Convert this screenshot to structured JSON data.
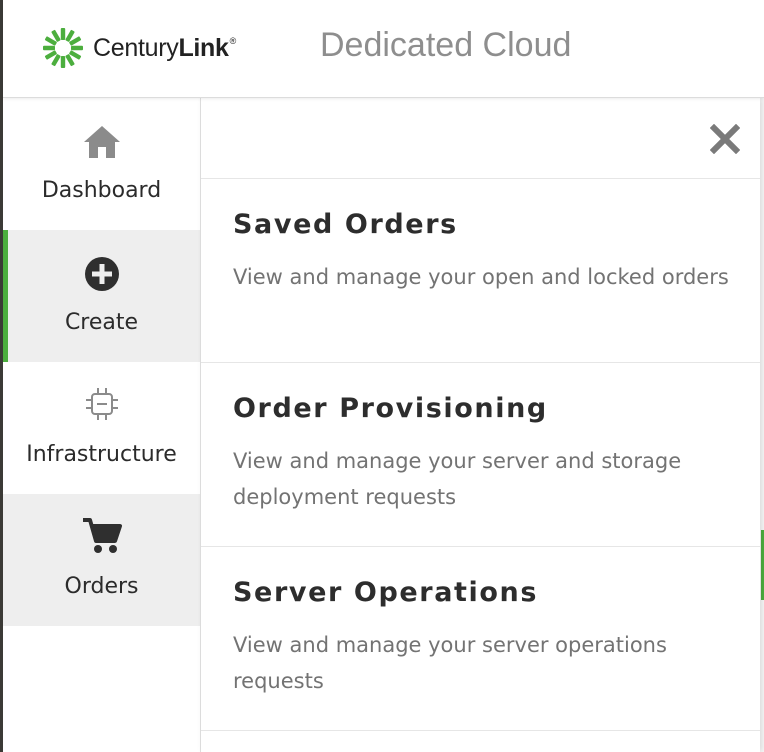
{
  "brand": {
    "logo_text_regular": "Century",
    "logo_text_bold": "Link",
    "logo_mark": "®",
    "logo_color": "#4cae3e"
  },
  "header": {
    "title": "Dedicated Cloud"
  },
  "sidebar": {
    "active_color": "#4cae3e",
    "items": [
      {
        "label": "Dashboard",
        "icon": "home-icon"
      },
      {
        "label": "Create",
        "icon": "plus-circle-icon",
        "active": true
      },
      {
        "label": "Infrastructure",
        "icon": "chip-icon"
      },
      {
        "label": "Orders",
        "icon": "cart-icon"
      }
    ]
  },
  "panel": {
    "close_icon": "close-icon",
    "items": [
      {
        "title": "Saved Orders",
        "description": "View and manage your open and locked orders"
      },
      {
        "title": "Order Provisioning",
        "description": "View and manage your server and storage deployment requests"
      },
      {
        "title": "Server Operations",
        "description": "View and manage your server operations requests"
      }
    ]
  }
}
